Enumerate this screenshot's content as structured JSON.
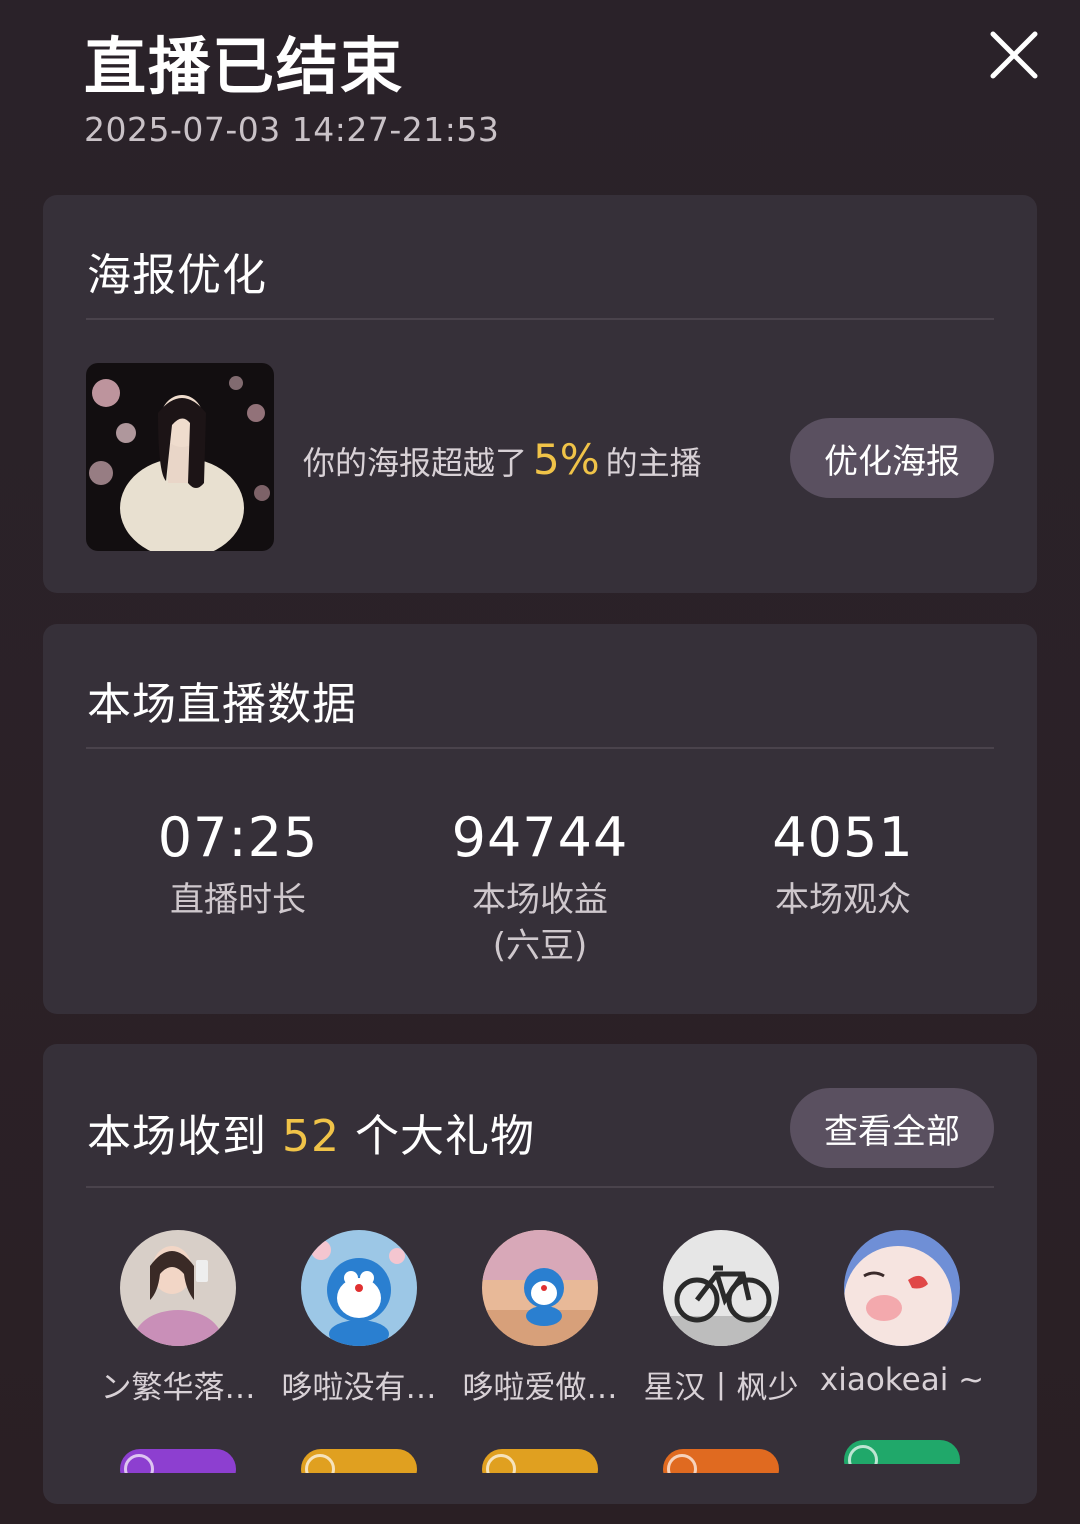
{
  "header": {
    "title": "直播已结束",
    "time_range": "2025-07-03 14:27-21:53",
    "close_icon": "close-icon"
  },
  "poster": {
    "title": "海报优化",
    "text_before": "你的海报超越了",
    "percent": "5%",
    "text_after": "的主播",
    "button": "优化海报"
  },
  "stats": {
    "title": "本场直播数据",
    "items": [
      {
        "value": "07:25",
        "label": "直播时长"
      },
      {
        "value": "94744",
        "label": "本场收益\n(六豆)"
      },
      {
        "value": "4051",
        "label": "本场观众"
      }
    ]
  },
  "gifts": {
    "title_before": "本场收到",
    "count": "52",
    "title_after": "个大礼物",
    "button": "查看全部",
    "users": [
      {
        "name": "ン繁华落…",
        "badge_color": "#8d3fd0"
      },
      {
        "name": "哆啦没有…",
        "badge_color": "#e0a020"
      },
      {
        "name": "哆啦爱做…",
        "badge_color": "#e0a020"
      },
      {
        "name": "星汉丨枫少",
        "badge_color": "#e06a20"
      },
      {
        "name": "xiaokeai ~",
        "badge_color": "#20a86a"
      }
    ]
  },
  "colors": {
    "accent": "#f0c348",
    "card_bg": "#363039",
    "button_bg": "#5a5060"
  }
}
